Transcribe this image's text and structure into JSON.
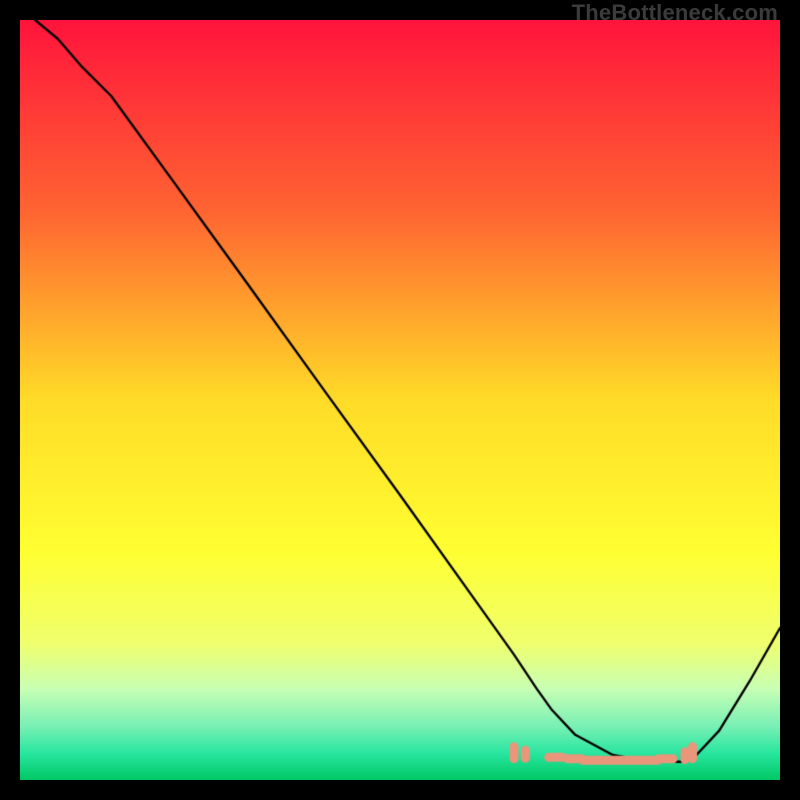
{
  "watermark": "TheBottleneck.com",
  "chart_data": {
    "type": "line",
    "title": "",
    "xlabel": "",
    "ylabel": "",
    "xlim": [
      0,
      100
    ],
    "ylim": [
      0,
      100
    ],
    "grid": false,
    "legend": false,
    "gradient_stops": [
      {
        "t": 0.0,
        "color": "#ff143c"
      },
      {
        "t": 0.25,
        "color": "#ff6432"
      },
      {
        "t": 0.5,
        "color": "#ffdc28"
      },
      {
        "t": 0.7,
        "color": "#ffff32"
      },
      {
        "t": 0.82,
        "color": "#f0ff6e"
      },
      {
        "t": 0.88,
        "color": "#c8ffb4"
      },
      {
        "t": 0.93,
        "color": "#78f0b4"
      },
      {
        "t": 0.965,
        "color": "#28e6a0"
      },
      {
        "t": 1.0,
        "color": "#00c864"
      }
    ],
    "series": [
      {
        "name": "curve",
        "stroke": "#000000",
        "stroke_width": 2.3,
        "x": [
          2,
          5,
          8,
          12,
          20,
          30,
          40,
          50,
          60,
          65,
          68,
          70,
          73,
          78,
          83,
          87,
          89,
          92,
          96,
          100
        ],
        "y": [
          100,
          97.5,
          94,
          90,
          79,
          65.2,
          51.3,
          37.5,
          23.5,
          16.5,
          12,
          9.2,
          6,
          3.3,
          2.4,
          2.4,
          3.3,
          6.5,
          13,
          20
        ]
      },
      {
        "name": "optimum-band",
        "type": "marker-run",
        "stroke": "#e9967a",
        "x": [
          65,
          66.5,
          70.5,
          73,
          75,
          77,
          79,
          81,
          83,
          85,
          87.5,
          88.5
        ],
        "y": [
          3.6,
          3.4,
          3.0,
          2.8,
          2.6,
          2.6,
          2.6,
          2.6,
          2.6,
          2.8,
          3.2,
          3.6
        ]
      }
    ]
  }
}
